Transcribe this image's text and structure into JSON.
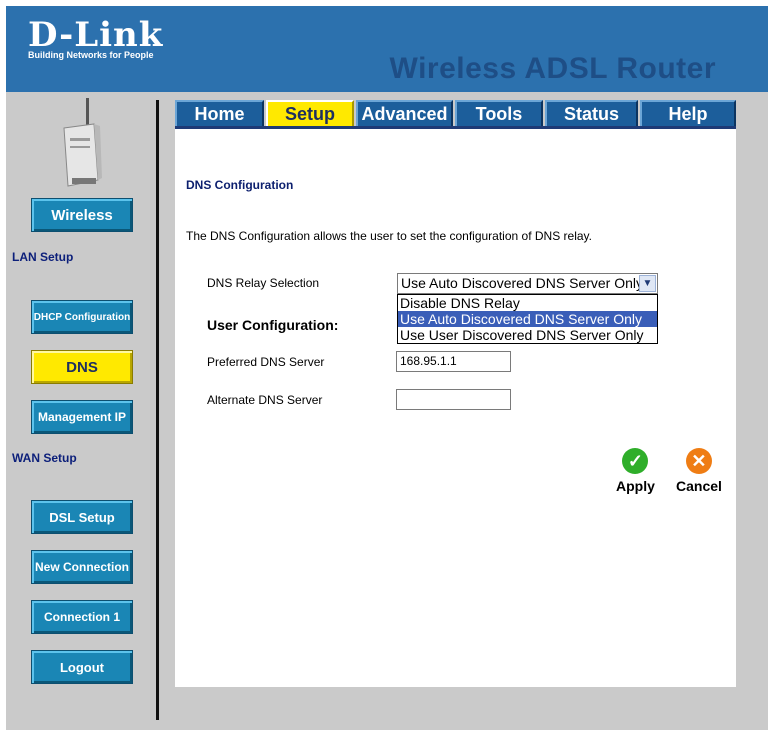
{
  "brand": {
    "logo": "D-Link",
    "tagline": "Building Networks for People",
    "product_title": "Wireless ADSL Router"
  },
  "tabs": [
    {
      "label": "Home",
      "active": false
    },
    {
      "label": "Setup",
      "active": true
    },
    {
      "label": "Advanced",
      "active": false
    },
    {
      "label": "Tools",
      "active": false
    },
    {
      "label": "Status",
      "active": false
    },
    {
      "label": "Help",
      "active": false
    }
  ],
  "sidebar": {
    "wireless": "Wireless",
    "lan_setup_label": "LAN Setup",
    "dhcp": "DHCP Configuration",
    "dns": "DNS",
    "management_ip": "Management IP",
    "wan_setup_label": "WAN Setup",
    "dsl_setup": "DSL Setup",
    "new_connection": "New Connection",
    "connection1": "Connection 1",
    "logout": "Logout"
  },
  "main": {
    "section_title": "DNS Configuration",
    "description": "The DNS Configuration allows the user to set the configuration of DNS relay.",
    "relay_label": "DNS Relay Selection",
    "relay_selected": "Use Auto Discovered DNS Server Only",
    "relay_options": [
      "Disable DNS Relay",
      "Use Auto Discovered DNS Server Only",
      "Use User Discovered DNS Server Only"
    ],
    "user_config_label": "User Configuration:",
    "preferred_label": "Preferred DNS Server",
    "preferred_value": "168.95.1.1",
    "alternate_label": "Alternate DNS Server",
    "alternate_value": ""
  },
  "actions": {
    "apply": "Apply",
    "cancel": "Cancel"
  },
  "colors": {
    "header_blue": "#2c71ae",
    "title_blue": "#1e4e86",
    "tab_blue": "#1c5e9b",
    "active_yellow": "#ffe900",
    "apply_green": "#2fae2a",
    "cancel_orange": "#ef7d14",
    "selection_blue": "#3a5eb8"
  }
}
